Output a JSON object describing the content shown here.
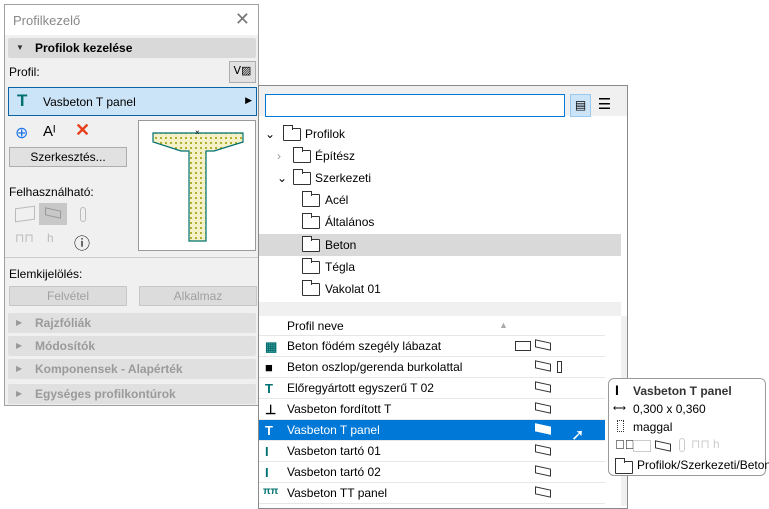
{
  "panel": {
    "title": "Profilkezelő",
    "section_main": "Profilok kezelése",
    "profile_label": "Profil:",
    "selected_profile": "Vasbeton T panel",
    "edit_button": "Szerkesztés...",
    "usable_label": "Felhasználható:",
    "selection_label": "Elemkijelölés:",
    "pick_button": "Felvétel",
    "apply_button": "Alkalmaz",
    "sections": [
      "Rajzfóliák",
      "Módosítók",
      "Komponensek - Alapérték",
      "Egységes profilkontúrok"
    ]
  },
  "popup": {
    "search_value": "",
    "tree": [
      {
        "label": "Profilok",
        "level": 0,
        "expanded": true
      },
      {
        "label": "Építész",
        "level": 1,
        "expanded": false
      },
      {
        "label": "Szerkezeti",
        "level": 1,
        "expanded": true
      },
      {
        "label": "Acél",
        "level": 2
      },
      {
        "label": "Általános",
        "level": 2
      },
      {
        "label": "Beton",
        "level": 2,
        "selected": true
      },
      {
        "label": "Tégla",
        "level": 2
      },
      {
        "label": "Vakolat 01",
        "level": 2
      }
    ],
    "list_header": "Profil neve",
    "list": [
      {
        "name": "Beton födém szegély lábazat",
        "icon": "▦"
      },
      {
        "name": "Beton oszlop/gerenda burkolattal",
        "icon": "■"
      },
      {
        "name": "Előregyártott egyszerű T 02",
        "icon": "T"
      },
      {
        "name": "Vasbeton fordított T",
        "icon": "⊥"
      },
      {
        "name": "Vasbeton T panel",
        "icon": "T",
        "selected": true
      },
      {
        "name": "Vasbeton tartó 01",
        "icon": "I"
      },
      {
        "name": "Vasbeton tartó 02",
        "icon": "I"
      },
      {
        "name": "Vasbeton TT panel",
        "icon": "ππ"
      }
    ]
  },
  "tooltip": {
    "title": "Vasbeton T panel",
    "size": "0,300 x 0,360",
    "core": "maggal",
    "path": "Profilok/Szerkezeti/Beton"
  },
  "colors": {
    "accent": "#0078d7",
    "selection_light": "#cce4f7",
    "profile_fill": "#d8d29a",
    "profile_stroke": "#007070"
  }
}
